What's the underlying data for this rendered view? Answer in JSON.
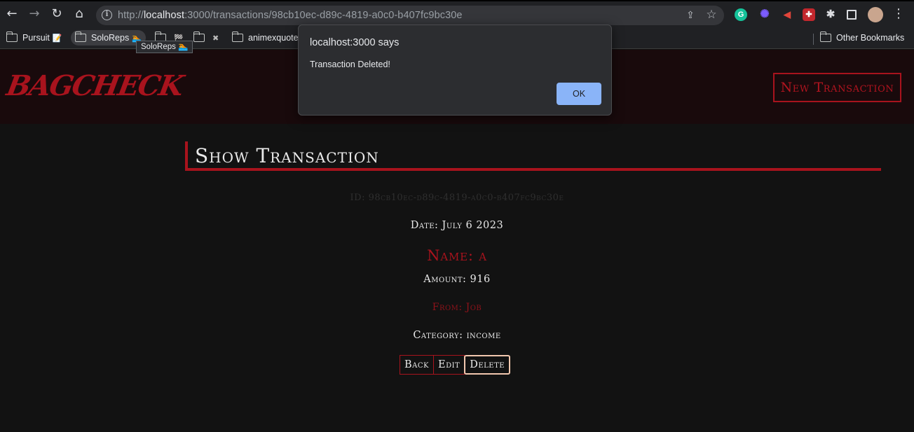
{
  "browser": {
    "url_scheme": "http://",
    "url_host": "localhost",
    "url_rest": ":3000/transactions/98cb10ec-d89c-4819-a0c0-b407fc9bc30e",
    "bookmarks": [
      {
        "label": "Pursuit",
        "emoji": "📝"
      },
      {
        "label": "SoloReps",
        "emoji": "🏊"
      },
      {
        "label": "",
        "emoji": "🏁"
      },
      {
        "label": "",
        "emoji": "✖"
      },
      {
        "label": "animexquote",
        "emoji": ""
      }
    ],
    "other_bookmarks": "Other Bookmarks",
    "tooltip": "SoloReps 🏊"
  },
  "app": {
    "logo": "BAGCHECK",
    "new_transaction": "New Transaction",
    "accent_color": "#a8131d"
  },
  "dialog": {
    "title": "localhost:3000 says",
    "message": "Transaction Deleted!",
    "ok_label": "OK",
    "ok_color": "#8ab4f8"
  },
  "transaction": {
    "heading": "Show Transaction",
    "id_line": "ID: 98cb10ec-d89c-4819-a0c0-b407fc9bc30e",
    "date_line": "Date: July 6 2023",
    "name_line": "Name: a",
    "amount_line": "Amount: 916",
    "from_line": "From: Job",
    "category_line": "Category: income"
  },
  "actions": {
    "back": "Back",
    "edit": "Edit",
    "delete": "Delete"
  }
}
